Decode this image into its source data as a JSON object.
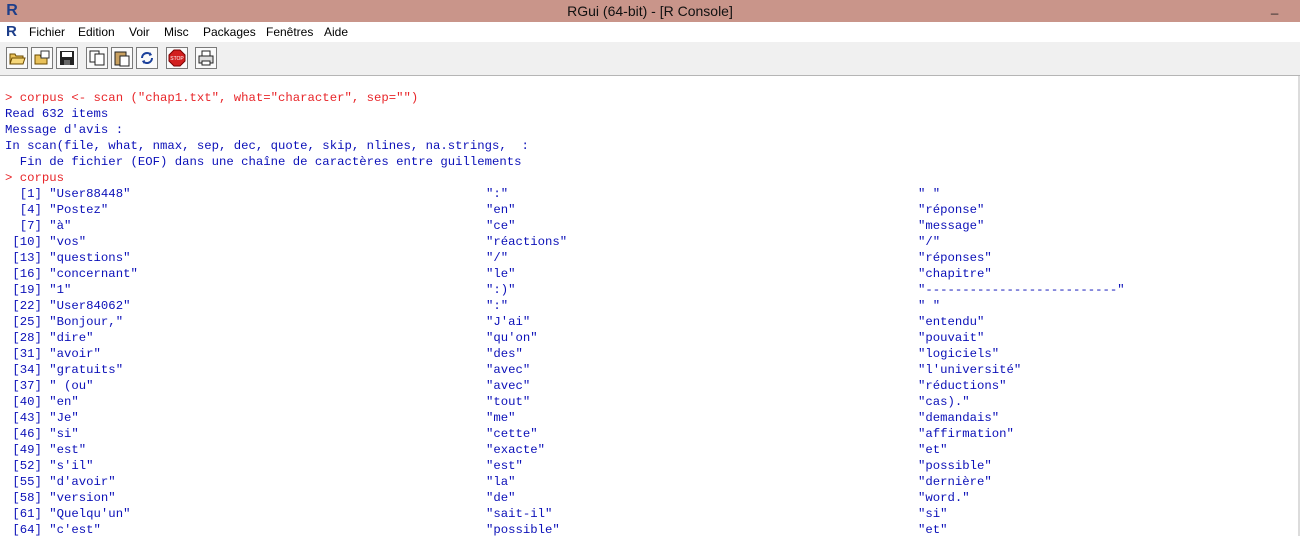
{
  "window": {
    "title": "RGui (64-bit) - [R Console]",
    "app_icon": "R",
    "minimize": "_"
  },
  "menu": {
    "icon": "R",
    "items": [
      "Fichier",
      "Edition",
      "Voir",
      "Misc",
      "Packages",
      "Fenêtres",
      "Aide"
    ]
  },
  "toolbar": {
    "buttons": [
      "open-script-icon",
      "load-workspace-icon",
      "save-icon",
      "copy-icon",
      "paste-icon",
      "copy-paste-icon",
      "stop-icon",
      "print-icon"
    ]
  },
  "console": {
    "lines": [
      {
        "text": "> corpus <- scan (\"chap1.txt\", what=\"character\", sep=\"\")",
        "type": "input"
      },
      {
        "text": "Read 632 items",
        "type": "output"
      },
      {
        "text": "Message d'avis :",
        "type": "output"
      },
      {
        "text": "In scan(file, what, nmax, sep, dec, quote, skip, nlines, na.strings,  :",
        "type": "output"
      },
      {
        "text": "  Fin de fichier (EOF) dans une chaîne de caractères entre guillements",
        "type": "output"
      },
      {
        "text": "> corpus",
        "type": "input"
      }
    ],
    "rows": [
      [
        "  [1] \"User88448\"",
        "\":\"",
        "\" \""
      ],
      [
        "  [4] \"Postez\"",
        "\"en\"",
        "\"réponse\""
      ],
      [
        "  [7] \"à\"",
        "\"ce\"",
        "\"message\""
      ],
      [
        " [10] \"vos\"",
        "\"réactions\"",
        "\"/\""
      ],
      [
        " [13] \"questions\"",
        "\"/\"",
        "\"réponses\""
      ],
      [
        " [16] \"concernant\"",
        "\"le\"",
        "\"chapitre\""
      ],
      [
        " [19] \"1\"",
        "\":)\"",
        "\"--------------------------\""
      ],
      [
        " [22] \"User84062\"",
        "\":\"",
        "\" \""
      ],
      [
        " [25] \"Bonjour,\"",
        "\"J'ai\"",
        "\"entendu\""
      ],
      [
        " [28] \"dire\"",
        "\"qu'on\"",
        "\"pouvait\""
      ],
      [
        " [31] \"avoir\"",
        "\"des\"",
        "\"logiciels\""
      ],
      [
        " [34] \"gratuits\"",
        "\"avec\"",
        "\"l'université\""
      ],
      [
        " [37] \" (ou\"",
        "\"avec\"",
        "\"réductions\""
      ],
      [
        " [40] \"en\"",
        "\"tout\"",
        "\"cas).\""
      ],
      [
        " [43] \"Je\"",
        "\"me\"",
        "\"demandais\""
      ],
      [
        " [46] \"si\"",
        "\"cette\"",
        "\"affirmation\""
      ],
      [
        " [49] \"est\"",
        "\"exacte\"",
        "\"et\""
      ],
      [
        " [52] \"s'il\"",
        "\"est\"",
        "\"possible\""
      ],
      [
        " [55] \"d'avoir\"",
        "\"la\"",
        "\"dernière\""
      ],
      [
        " [58] \"version\"",
        "\"de\"",
        "\"word.\""
      ],
      [
        " [61] \"Quelqu'un\"",
        "\"sait-il\"",
        "\"si\""
      ],
      [
        " [64] \"c'est\"",
        "\"possible\"",
        "\"et\""
      ]
    ]
  },
  "colors": {
    "title_bar": "#c9958a",
    "input_text": "#e8262a",
    "output_text": "#0b10b8"
  }
}
